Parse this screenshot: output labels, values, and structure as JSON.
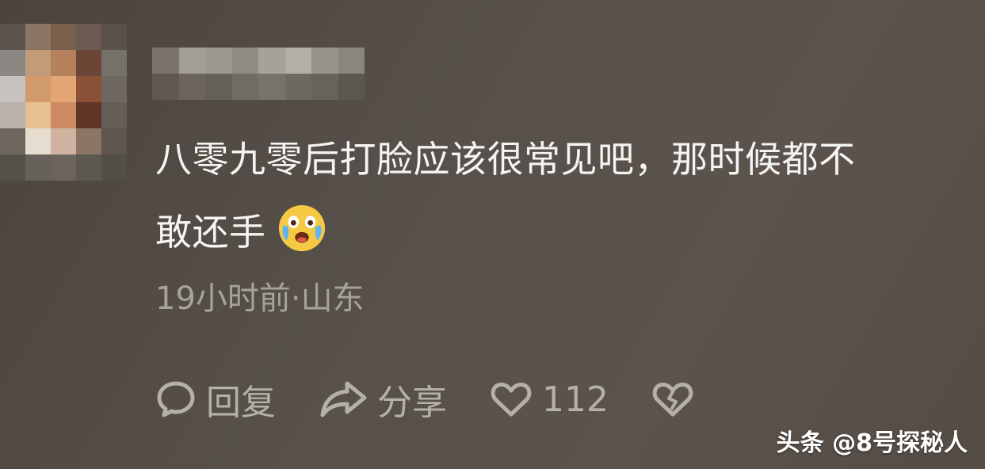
{
  "comment": {
    "text_line1": "八零九零后打脸应该很常见吧，那时候都不",
    "text_line2": "敢还手",
    "emoji": "crying-laughing-emoji",
    "meta": "19小时前·山东"
  },
  "actions": {
    "reply_label": "回复",
    "share_label": "分享",
    "like_count": "112"
  },
  "watermark": "头条 @8号探秘人",
  "colors": {
    "background": "#544c45",
    "text": "#f4f4f4",
    "meta": "#a7a29c",
    "icon": "#b5b0aa"
  }
}
